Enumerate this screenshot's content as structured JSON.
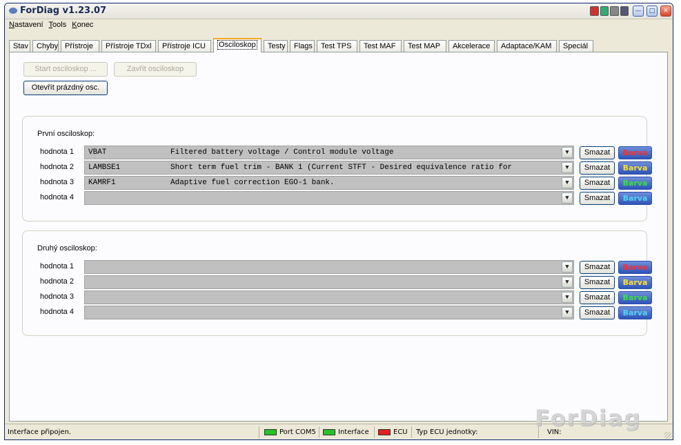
{
  "window": {
    "title": "ForDiag v1.23.07"
  },
  "menu": [
    "Nastavení",
    "Tools",
    "Konec"
  ],
  "tabs": [
    {
      "label": "Stav",
      "w": 31
    },
    {
      "label": "Chyby",
      "w": 38
    },
    {
      "label": "Přístroje",
      "w": 56
    },
    {
      "label": "Přístroje TDxl",
      "w": 79
    },
    {
      "label": "Přístroje ICU",
      "w": 77
    },
    {
      "label": "Osciloskop",
      "w": 70,
      "active": true
    },
    {
      "label": "Testy",
      "w": 35
    },
    {
      "label": "Flags",
      "w": 36
    },
    {
      "label": "Test TPS",
      "w": 59
    },
    {
      "label": "Test MAF",
      "w": 61
    },
    {
      "label": "Test MAP",
      "w": 62
    },
    {
      "label": "Akcelerace",
      "w": 67
    },
    {
      "label": "Adaptace/KAM",
      "w": 87
    },
    {
      "label": "Speciál",
      "w": 50
    }
  ],
  "buttons": {
    "start": "Start osciloskop ...",
    "close": "Zavřít osciloskop",
    "open_empty": "Otevřít prázdný osc."
  },
  "groups": [
    {
      "label": "První osciloskop:",
      "rows": [
        {
          "label": "hodnota 1",
          "code": "VBAT",
          "desc": "Filtered battery voltage / Control module voltage"
        },
        {
          "label": "hodnota 2",
          "code": "LAMBSE1",
          "desc": "Short term fuel trim - BANK 1 (Current STFT - Desired equivalence ratio for"
        },
        {
          "label": "hodnota 3",
          "code": "KAMRF1",
          "desc": "Adaptive fuel correction EGO-1 bank."
        },
        {
          "label": "hodnota 4",
          "code": "",
          "desc": ""
        }
      ]
    },
    {
      "label": "Druhý osciloskop:",
      "rows": [
        {
          "label": "hodnota 1",
          "code": "",
          "desc": ""
        },
        {
          "label": "hodnota 2",
          "code": "",
          "desc": ""
        },
        {
          "label": "hodnota 3",
          "code": "",
          "desc": ""
        },
        {
          "label": "hodnota 4",
          "code": "",
          "desc": ""
        }
      ]
    }
  ],
  "row_buttons": {
    "smazat": "Smazat",
    "barva": "Barva"
  },
  "barva_colors": [
    "#ff2b2b",
    "#ffe02b",
    "#39e339",
    "#52d4f0"
  ],
  "statusbar": {
    "message": "Interface připojen.",
    "port": "Port COM5",
    "interface": "Interface",
    "ecu": "ECU",
    "ecu_type": "Typ ECU jednotky:",
    "vin": "VIN:"
  },
  "watermark": "ForDiag"
}
